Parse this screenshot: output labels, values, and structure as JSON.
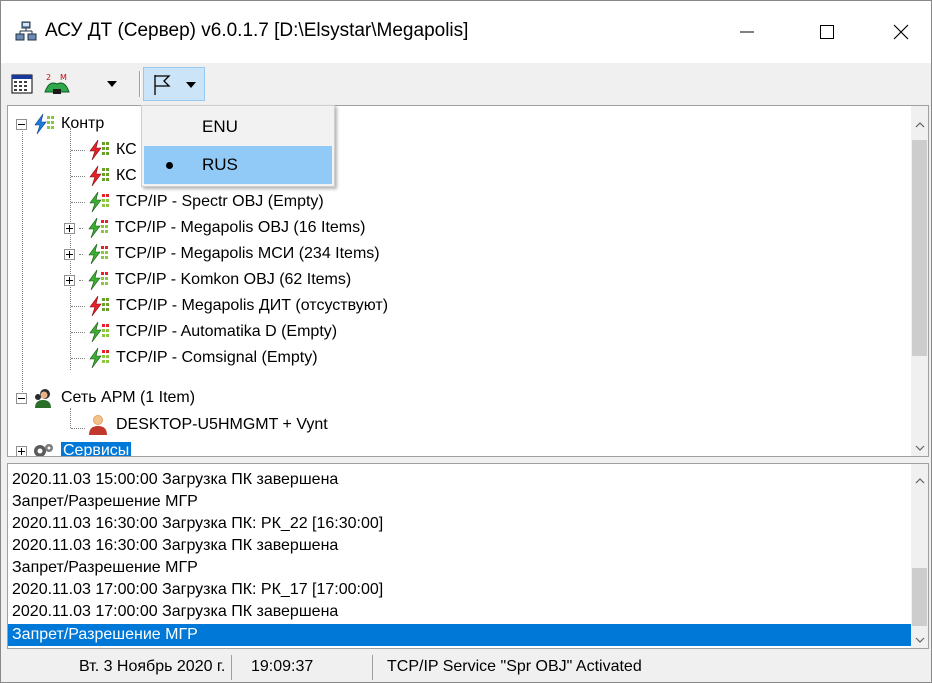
{
  "window": {
    "title": "АСУ ДТ (Сервер) v6.0.1.7 [D:\\Elsystar\\Megapolis]"
  },
  "toolbar": {
    "icons": [
      "calendar-icon",
      "tree-icon",
      "flag-icon"
    ]
  },
  "language_menu": {
    "items": [
      {
        "label": "ENU",
        "checked": false
      },
      {
        "label": "RUS",
        "checked": true
      }
    ]
  },
  "tree": {
    "root": {
      "label": "Контр",
      "icon": "lightning-icon"
    },
    "children": [
      {
        "label": "КС",
        "status": "red",
        "expandable": false
      },
      {
        "label": "КС",
        "status": "red",
        "expandable": false
      },
      {
        "label": "TCP/IP - Spectr OBJ  (Empty)",
        "status": "green",
        "expandable": false
      },
      {
        "label": "TCP/IP - Megapolis OBJ  (16 Items)",
        "status": "green",
        "expandable": true
      },
      {
        "label": "TCP/IP - Megapolis МСИ (234 Items)",
        "status": "green",
        "expandable": true
      },
      {
        "label": "TCP/IP - Komkon OBJ  (62 Items)",
        "status": "green",
        "expandable": true
      },
      {
        "label": "TCP/IP - Megapolis ДИТ (отсуствуют)",
        "status": "red",
        "expandable": false
      },
      {
        "label": "TCP/IP - Automatika D  (Empty)",
        "status": "green",
        "expandable": false
      },
      {
        "label": "TCP/IP - Comsignal  (Empty)",
        "status": "green",
        "expandable": false
      }
    ],
    "arm_group": {
      "label": "Сеть АРМ (1 Item)"
    },
    "arm_child": {
      "label": "DESKTOP-U5HMGMT + Vynt"
    },
    "service_node": {
      "label": "Сервисы"
    }
  },
  "log": {
    "lines": [
      "2020.11.03 15:00:00 Загрузка ПК завершена",
      " Запрет/Разрешение МГР",
      "2020.11.03 16:30:00 Загрузка ПК: РК_22 [16:30:00]",
      "2020.11.03 16:30:00 Загрузка ПК завершена",
      " Запрет/Разрешение МГР",
      "2020.11.03 17:00:00 Загрузка ПК: РК_17 [17:00:00]",
      "2020.11.03 17:00:00 Загрузка ПК завершена",
      " Запрет/Разрешение МГР"
    ],
    "selected_index": 7
  },
  "status": {
    "date": "Вт. 3 Ноябрь 2020 г.",
    "time": "19:09:37",
    "message": "TCP/IP Service \"Spr OBJ\" Activated"
  },
  "colors": {
    "selection": "#0078d7",
    "menu_hover": "#91c9f7",
    "status_red": "#e8202a",
    "status_green": "#3cb030"
  }
}
